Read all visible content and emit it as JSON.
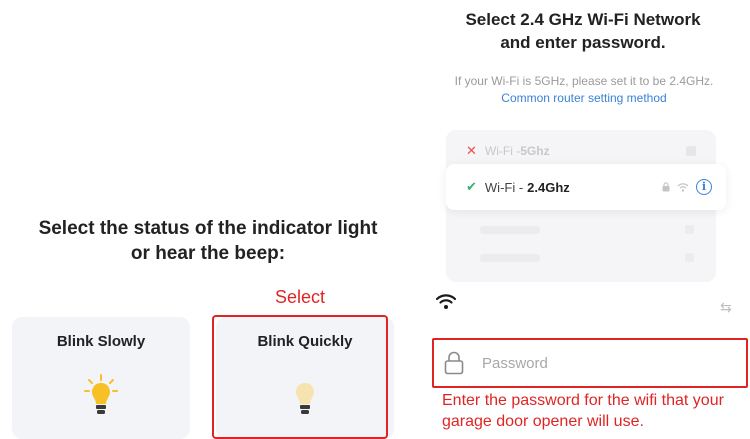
{
  "left": {
    "title_line1": "Select the status of the indicator light",
    "title_line2": "or hear the beep:",
    "select_label": "Select",
    "modes": [
      {
        "label": "Blink Slowly",
        "icon": "lightbulb-bright-icon",
        "selected": false
      },
      {
        "label": "Blink Quickly",
        "icon": "lightbulb-dim-icon",
        "selected": true
      }
    ]
  },
  "right": {
    "title_line1": "Select 2.4 GHz Wi-Fi Network",
    "title_line2": "and enter password.",
    "desc_text": "If your Wi-Fi is 5GHz, please set it to be 2.4GHz. ",
    "desc_link": "Common router setting method",
    "networks": {
      "bad_prefix": "Wi-Fi - ",
      "bad_band": "5Ghz",
      "good_prefix": "Wi-Fi - ",
      "good_band": "2.4Ghz"
    },
    "password_placeholder": "Password",
    "note": "Enter the password for the wifi that your garage door opener will use."
  },
  "colors": {
    "highlight": "#e02424",
    "link": "#3b82d6",
    "ok": "#35b06a",
    "bulb_bright": "#f6c026",
    "bulb_dim": "#f7e3b0"
  }
}
